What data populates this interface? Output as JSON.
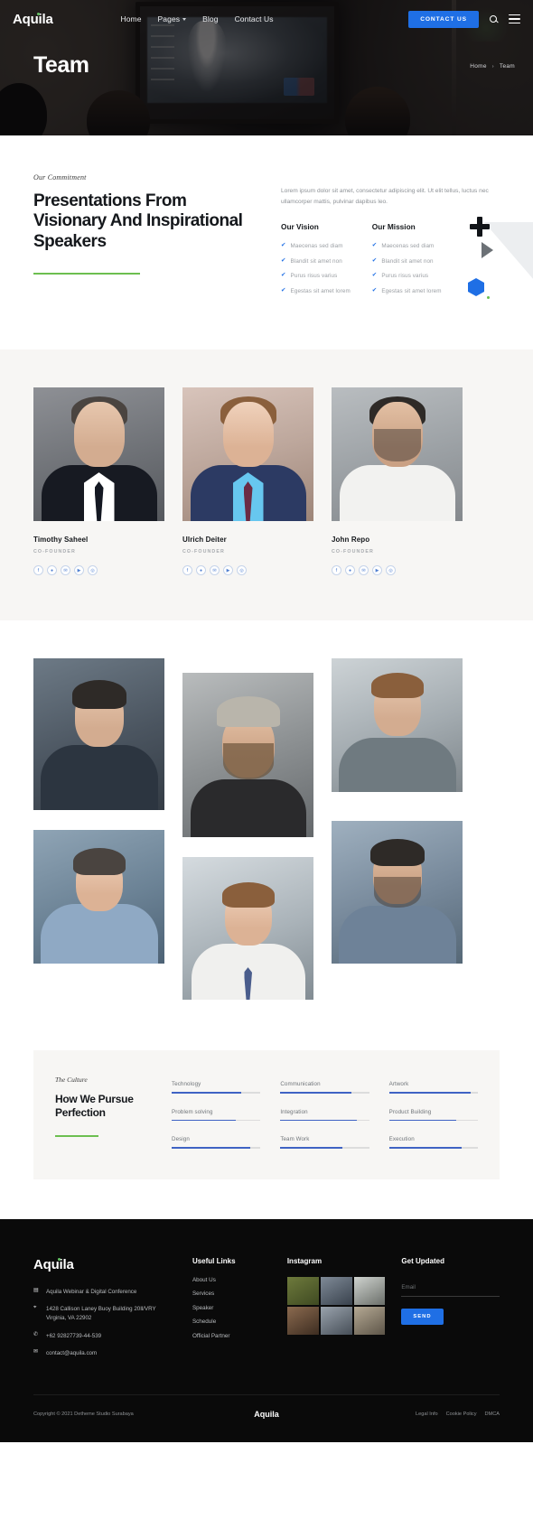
{
  "nav": {
    "brand": "Aquila",
    "links": [
      {
        "label": "Home",
        "has_caret": false
      },
      {
        "label": "Pages",
        "has_caret": true
      },
      {
        "label": "Blog",
        "has_caret": false
      },
      {
        "label": "Contact Us",
        "has_caret": false
      }
    ],
    "cta_label": "CONTACT US",
    "search_icon": "search-icon",
    "menu_icon": "hamburger-icon"
  },
  "hero": {
    "title": "Team",
    "breadcrumb": {
      "home": "Home",
      "separator": "›",
      "current": "Team"
    }
  },
  "commitment": {
    "eyebrow": "Our Commitment",
    "heading": "Presentations From Visionary And Inspirational Speakers",
    "lead": "Lorem ipsum dolor sit amet, consectetur adipiscing elit. Ut elit tellus, luctus nec ullamcorper mattis, pulvinar dapibus leo.",
    "columns": [
      {
        "title": "Our Vision",
        "items": [
          "Maecenas sed diam",
          "Blandit sit amet non",
          "Purus risus varius",
          "Egestas sit amet lorem"
        ]
      },
      {
        "title": "Our Mission",
        "items": [
          "Maecenas sed diam",
          "Blandit sit amet non",
          "Purus risus varius",
          "Egestas sit amet lorem"
        ]
      }
    ],
    "tick_glyph": "✔"
  },
  "team": {
    "members": [
      {
        "name": "Timothy Saheel",
        "role": "CO-FOUNDER"
      },
      {
        "name": "Ulrich Deiter",
        "role": "CO-FOUNDER"
      },
      {
        "name": "John Repo",
        "role": "CO-FOUNDER"
      }
    ],
    "social_icons": [
      "facebook-icon",
      "dribbble-icon",
      "twitter-icon",
      "youtube-icon",
      "instagram-icon"
    ],
    "social_glyphs": [
      "f",
      "●",
      "✉",
      "▶",
      "◎"
    ]
  },
  "culture": {
    "eyebrow": "The Culture",
    "heading": "How We Pursue Perfection",
    "skills": [
      {
        "label": "Technology",
        "percent": 78
      },
      {
        "label": "Communication",
        "percent": 80
      },
      {
        "label": "Artwork",
        "percent": 92
      },
      {
        "label": "Problem solving",
        "percent": 72
      },
      {
        "label": "Integration",
        "percent": 86
      },
      {
        "label": "Product Building",
        "percent": 76
      },
      {
        "label": "Design",
        "percent": 88
      },
      {
        "label": "Team Work",
        "percent": 70
      },
      {
        "label": "Execution",
        "percent": 82
      }
    ]
  },
  "footer": {
    "brand": "Aquila",
    "info": [
      {
        "icon": "building-icon",
        "glyph": "▤",
        "text": "Aquila Webinar & Digital Conference"
      },
      {
        "icon": "location-pin-icon",
        "glyph": "⌖",
        "text": "1428 Callison Laney Buoy Building 20Ⅱ/VRY Virginia, VA 22902"
      },
      {
        "icon": "phone-icon",
        "glyph": "✆",
        "text": "+62 92827739-44-539"
      },
      {
        "icon": "envelope-icon",
        "glyph": "✉",
        "text": "contact@aquila.com"
      }
    ],
    "useful_links_title": "Useful Links",
    "useful_links": [
      "About Us",
      "Services",
      "Speaker",
      "Schedule",
      "Official Partner"
    ],
    "instagram_title": "Instagram",
    "newsletter_title": "Get Updated",
    "newsletter_placeholder": "Email",
    "newsletter_value": "",
    "send_label": "SEND",
    "copyright": "Copyright © 2021 Detheme Studio Surabaya",
    "bottom_logo": "Aquila",
    "bottom_links": [
      "Legal Info",
      "Cookie Policy",
      "DMCA"
    ]
  },
  "colors": {
    "accent_blue": "#1f6fe5",
    "accent_green": "#6cbf50",
    "dark": "#0a0a0a",
    "panel": "#f7f6f4"
  }
}
